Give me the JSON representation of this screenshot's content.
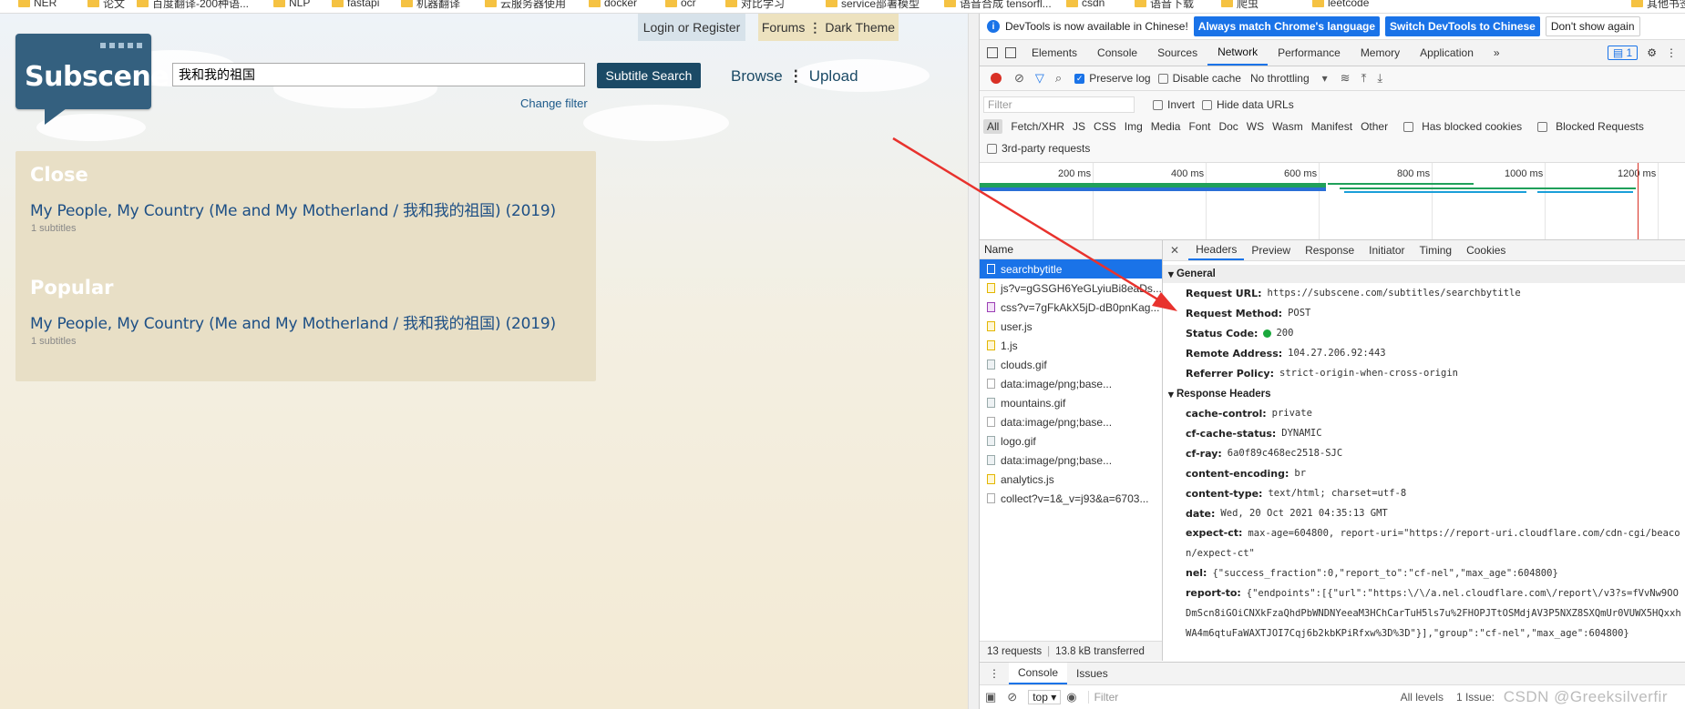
{
  "bookmarks": [
    "NER",
    "论文",
    "百度翻译-200种语...",
    "NLP",
    "fastapi",
    "机器翻译",
    "云服务器使用",
    "docker",
    "ocr",
    "对比学习",
    "service部署模型",
    "语音合成 tensorfl...",
    "csdn",
    "语音下载",
    "爬虫",
    "leetcode",
    "其他书签"
  ],
  "site": {
    "top_login": "Login or Register",
    "top_forums": "Forums",
    "top_dark": "Dark Theme",
    "logo": "Subscene",
    "search_value": "我和我的祖国",
    "search_button": "Subtitle Search",
    "change_filter": "Change filter",
    "browse": "Browse",
    "upload": "Upload",
    "close_title": "Close",
    "close_result": "My People, My Country (Me and My Motherland / 我和我的祖国) (2019)",
    "close_count": "1 subtitles",
    "popular_title": "Popular",
    "popular_result": "My People, My Country (Me and My Motherland / 我和我的祖国) (2019)",
    "popular_count": "1 subtitles"
  },
  "devtools": {
    "banner_text": "DevTools is now available in Chinese!",
    "banner_btn1": "Always match Chrome's language",
    "banner_btn2": "Switch DevTools to Chinese",
    "banner_btn3": "Don't show again",
    "tabs": [
      "Elements",
      "Console",
      "Sources",
      "Network",
      "Performance",
      "Memory",
      "Application"
    ],
    "issues_count": "1",
    "preserve_log": "Preserve log",
    "disable_cache": "Disable cache",
    "throttling": "No throttling",
    "filter_placeholder": "Filter",
    "invert": "Invert",
    "hide_data_urls": "Hide data URLs",
    "types": [
      "All",
      "Fetch/XHR",
      "JS",
      "CSS",
      "Img",
      "Media",
      "Font",
      "Doc",
      "WS",
      "Wasm",
      "Manifest",
      "Other"
    ],
    "has_blocked_cookies": "Has blocked cookies",
    "blocked_requests": "Blocked Requests",
    "third_party": "3rd-party requests",
    "timeline_labels": [
      "200 ms",
      "400 ms",
      "600 ms",
      "800 ms",
      "1000 ms",
      "1200 ms"
    ],
    "list_header": "Name",
    "requests": [
      {
        "name": "searchbytitle",
        "kind": "doc"
      },
      {
        "name": "js?v=gGSGH6YeGLyiuBi8eaDs...",
        "kind": "js"
      },
      {
        "name": "css?v=7gFkAkX5jD-dB0pnKag...",
        "kind": "css"
      },
      {
        "name": "user.js",
        "kind": "js"
      },
      {
        "name": "1.js",
        "kind": "js"
      },
      {
        "name": "clouds.gif",
        "kind": "img"
      },
      {
        "name": "data:image/png;base...",
        "kind": "none"
      },
      {
        "name": "mountains.gif",
        "kind": "img"
      },
      {
        "name": "data:image/png;base...",
        "kind": "none"
      },
      {
        "name": "logo.gif",
        "kind": "img"
      },
      {
        "name": "data:image/png;base...",
        "kind": "img"
      },
      {
        "name": "analytics.js",
        "kind": "js"
      },
      {
        "name": "collect?v=1&_v=j93&a=6703...",
        "kind": "none"
      }
    ],
    "footer_requests": "13 requests",
    "footer_transferred": "13.8 kB transferred",
    "detail_tabs": [
      "Headers",
      "Preview",
      "Response",
      "Initiator",
      "Timing",
      "Cookies"
    ],
    "general_title": "General",
    "general": [
      {
        "k": "Request URL:",
        "v": "https://subscene.com/subtitles/searchbytitle"
      },
      {
        "k": "Request Method:",
        "v": "POST"
      },
      {
        "k": "Status Code:",
        "v": "200"
      },
      {
        "k": "Remote Address:",
        "v": "104.27.206.92:443"
      },
      {
        "k": "Referrer Policy:",
        "v": "strict-origin-when-cross-origin"
      }
    ],
    "response_title": "Response Headers",
    "response": [
      {
        "k": "cache-control:",
        "v": "private"
      },
      {
        "k": "cf-cache-status:",
        "v": "DYNAMIC"
      },
      {
        "k": "cf-ray:",
        "v": "6a0f89c468ec2518-SJC"
      },
      {
        "k": "content-encoding:",
        "v": "br"
      },
      {
        "k": "content-type:",
        "v": "text/html; charset=utf-8"
      },
      {
        "k": "date:",
        "v": "Wed, 20 Oct 2021 04:35:13 GMT"
      },
      {
        "k": "expect-ct:",
        "v": "max-age=604800, report-uri=\"https://report-uri.cloudflare.com/cdn-cgi/beacon/expect-ct\""
      },
      {
        "k": "nel:",
        "v": "{\"success_fraction\":0,\"report_to\":\"cf-nel\",\"max_age\":604800}"
      },
      {
        "k": "report-to:",
        "v": "{\"endpoints\":[{\"url\":\"https:\\/\\/a.nel.cloudflare.com\\/report\\/v3?s=fVvNw9OODmScn8iGOiCNXkFzaQhdPbWNDNYeeaM3HChCarTuH5ls7u%2FHOPJTtOSMdjAV3P5NXZ8SXQmUr0VUWX5HQxxhWA4m6qtuFaWAXTJOI7Cqj6b2kbKPiRfxw%3D%3D\"}],\"group\":\"cf-nel\",\"max_age\":604800}"
      }
    ],
    "console_tabs": [
      "Console",
      "Issues"
    ],
    "console_context": "top",
    "console_filter": "Filter",
    "console_levels": "All levels",
    "console_issues": "1 Issue:"
  },
  "watermark": "CSDN @Greeksilverfir",
  "colors": {
    "accent": "#1a73e8",
    "logo": "#34607f",
    "arrow": "#e8322d",
    "result_panel": "#e8dfc6"
  }
}
